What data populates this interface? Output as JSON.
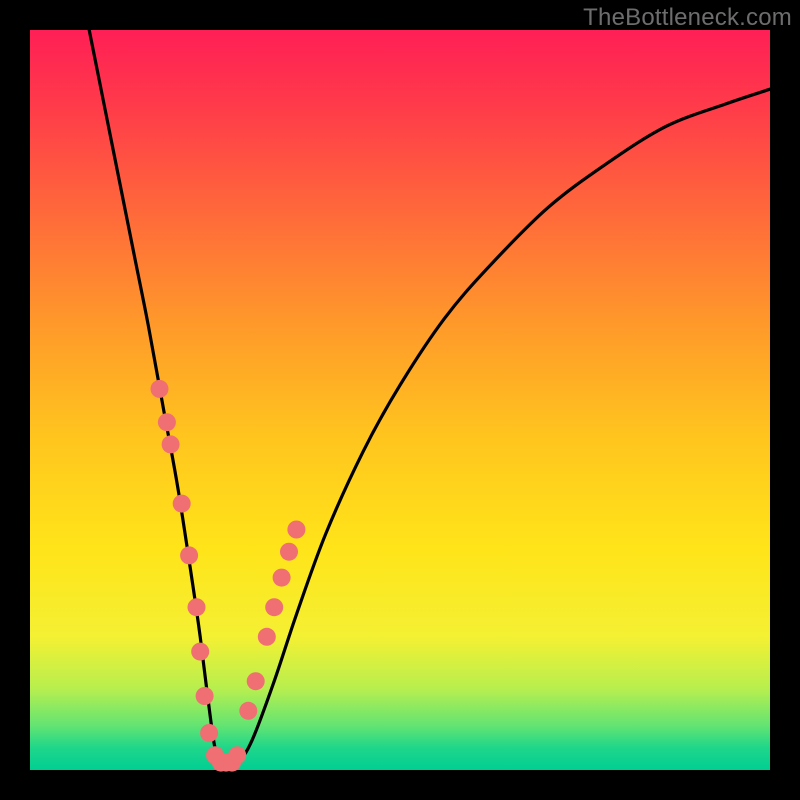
{
  "watermark": "TheBottleneck.com",
  "chart_data": {
    "type": "line",
    "title": "",
    "xlabel": "",
    "ylabel": "",
    "xlim": [
      0,
      100
    ],
    "ylim": [
      0,
      100
    ],
    "grid": false,
    "series": [
      {
        "name": "bottleneck-curve",
        "x": [
          8,
          10,
          12,
          14,
          16,
          18,
          20,
          22,
          23,
          24,
          25,
          26,
          28,
          30,
          33,
          36,
          40,
          45,
          50,
          56,
          62,
          70,
          78,
          86,
          94,
          100
        ],
        "y": [
          100,
          90,
          80,
          70,
          60,
          49,
          38,
          25,
          18,
          10,
          3,
          1,
          1,
          4,
          12,
          21,
          32,
          43,
          52,
          61,
          68,
          76,
          82,
          87,
          90,
          92
        ]
      }
    ],
    "markers": {
      "name": "highlight-dots",
      "color": "#ef6f72",
      "x": [
        17.5,
        18.5,
        19.0,
        20.5,
        21.5,
        22.5,
        23.0,
        23.6,
        24.2,
        25.0,
        25.8,
        26.5,
        27.3,
        28.0,
        29.5,
        30.5,
        32.0,
        33.0,
        34.0,
        35.0,
        36.0
      ],
      "y": [
        51.5,
        47.0,
        44.0,
        36.0,
        29.0,
        22.0,
        16.0,
        10.0,
        5.0,
        2.0,
        1.0,
        1.0,
        1.0,
        2.0,
        8.0,
        12.0,
        18.0,
        22.0,
        26.0,
        29.5,
        32.5
      ]
    }
  }
}
